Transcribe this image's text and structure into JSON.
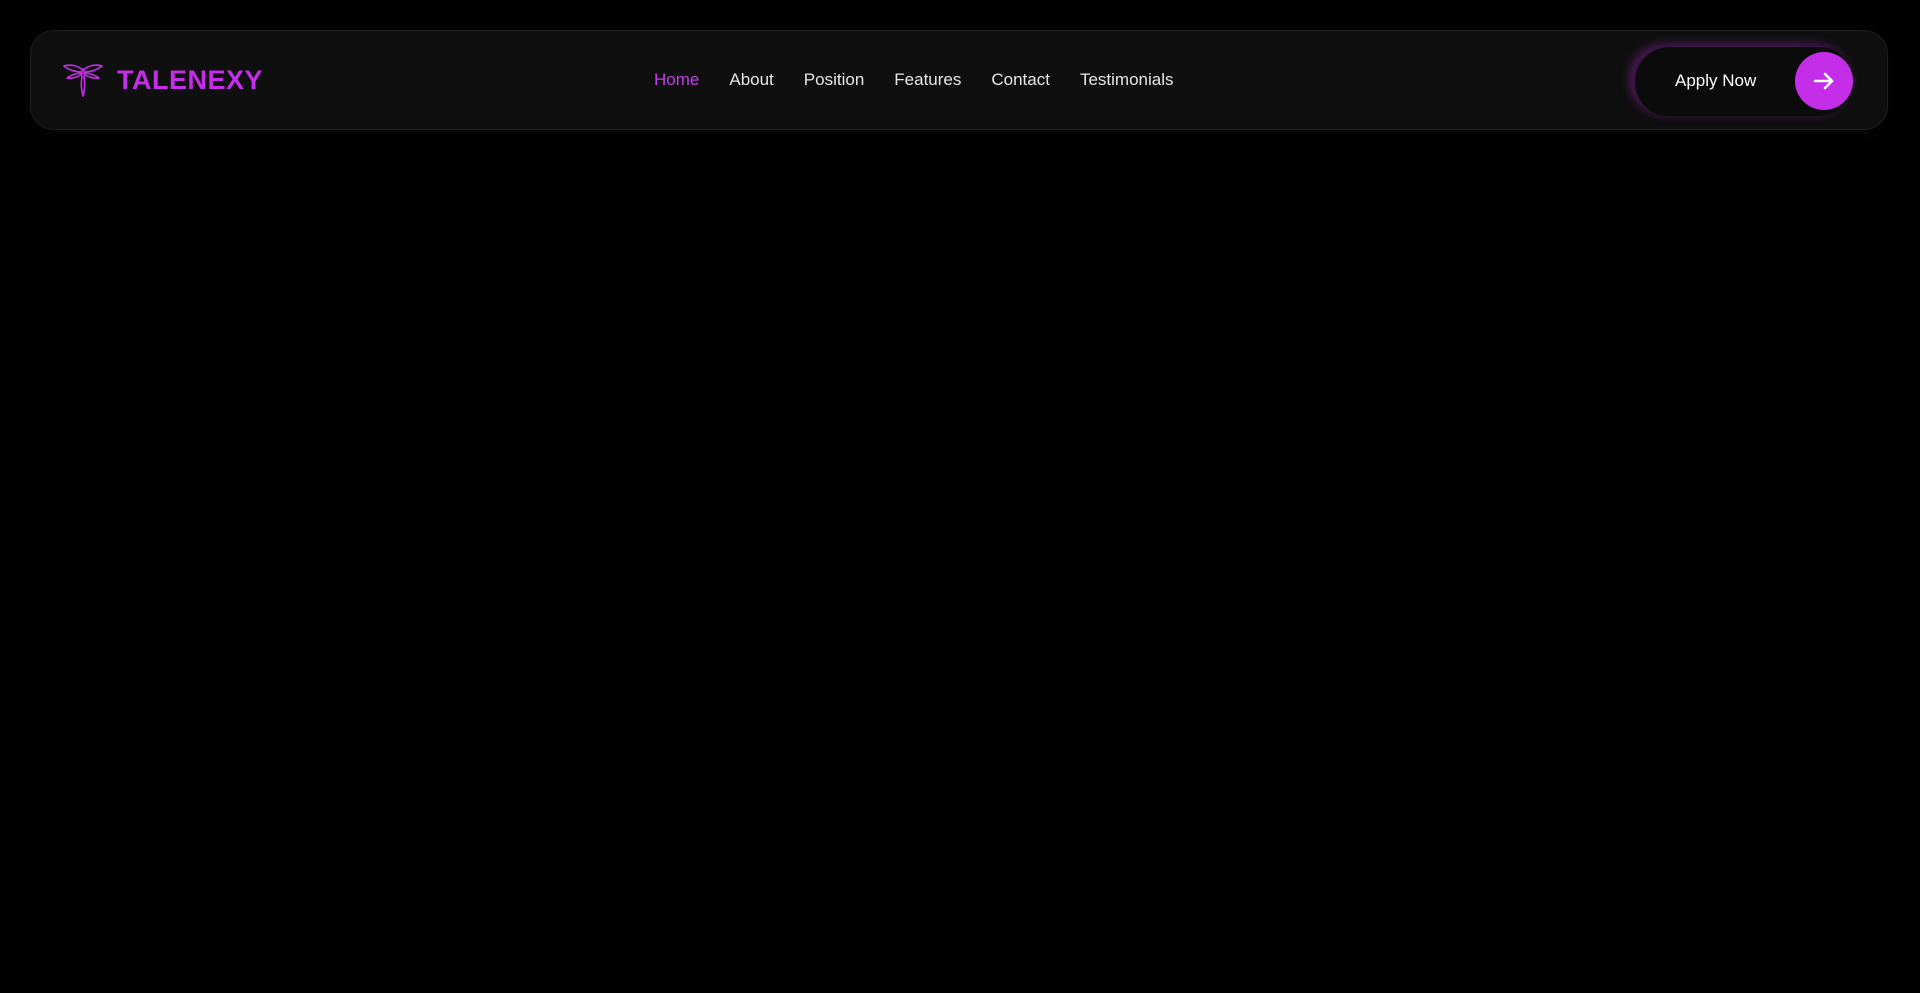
{
  "brand": {
    "name": "TALENEXY",
    "logo_icon": "dragonfly-logo-icon",
    "color": "#c52ee8"
  },
  "nav": {
    "items": [
      {
        "label": "Home",
        "active": true
      },
      {
        "label": "About",
        "active": false
      },
      {
        "label": "Position",
        "active": false
      },
      {
        "label": "Features",
        "active": false
      },
      {
        "label": "Contact",
        "active": false
      },
      {
        "label": "Testimonials",
        "active": false
      }
    ],
    "active_color": "#c43fe6",
    "text_color": "#e6e6e6"
  },
  "cta": {
    "label": "Apply Now",
    "icon": "arrow-right-icon",
    "accent": "#c52ee8"
  },
  "page": {
    "background": "#000000"
  }
}
